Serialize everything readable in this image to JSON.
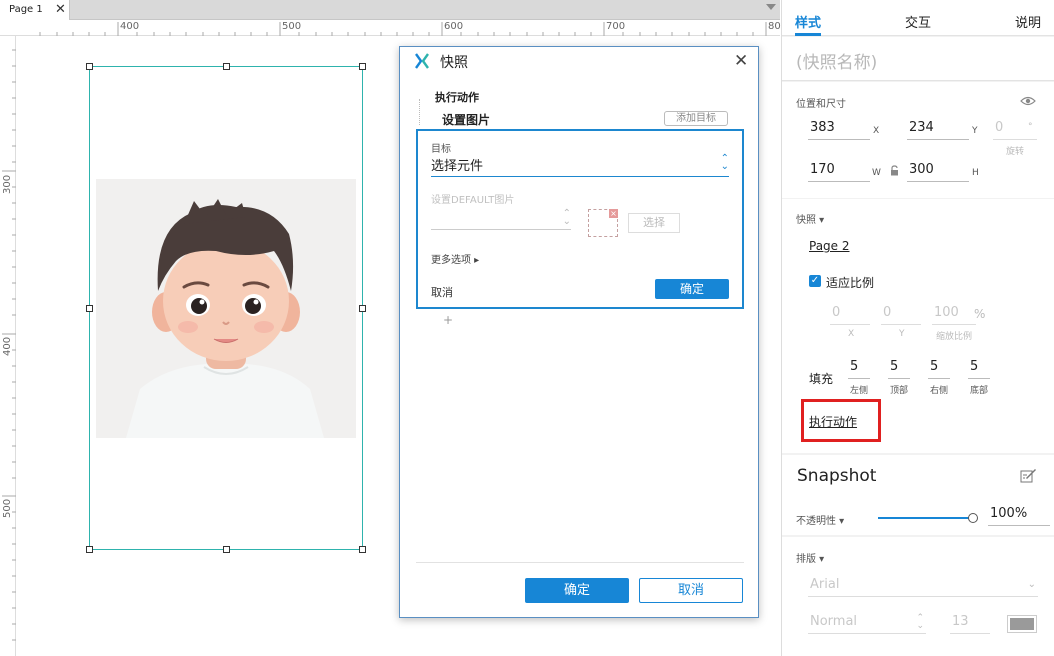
{
  "tabbar": {
    "page_tab": "Page 1",
    "close_glyph": "✕"
  },
  "ruler": {
    "top_labels": [
      "400",
      "500",
      "600",
      "700",
      "80"
    ],
    "left_labels": [
      "300",
      "400",
      "500"
    ]
  },
  "dialog": {
    "title": "快照",
    "close_glyph": "✕",
    "action_header": "执行动作",
    "action_sub": "设置图片",
    "add_target": "添加目标",
    "target_label": "目标",
    "target_select": "选择元件",
    "default_image_label": "设置DEFAULT图片",
    "choose_button": "选择",
    "more_options": "更多选项 ▸",
    "cancel_link": "取消",
    "ok_small": "确定",
    "add_plus": "+",
    "ok_button": "确定",
    "cancel_button": "取消"
  },
  "panel": {
    "tabs": {
      "style": "样式",
      "interact": "交互",
      "notes": "说明"
    },
    "snapshot_name_placeholder": "(快照名称)",
    "position_size": {
      "label": "位置和尺寸",
      "x": "383",
      "x_unit": "X",
      "y": "234",
      "y_unit": "Y",
      "rotation": "0",
      "rotation_unit": "°",
      "rotation_label": "旋转",
      "w": "170",
      "w_unit": "W",
      "h": "300",
      "h_unit": "H"
    },
    "snapshot": {
      "label": "快照 ▾",
      "page_link": "Page 2",
      "fit_checkbox": "适应比例",
      "fit_checked": true,
      "offset_x": "0",
      "offset_x_unit": "X",
      "offset_y": "0",
      "offset_y_unit": "Y",
      "scale": "100",
      "scale_unit": "%",
      "scale_label": "缩放比例"
    },
    "padding": {
      "label": "填充",
      "left": "5",
      "left_label": "左侧",
      "top": "5",
      "top_label": "顶部",
      "right": "5",
      "right_label": "右侧",
      "bottom": "5",
      "bottom_label": "底部"
    },
    "action_link": "执行动作",
    "snapshot_section_title": "Snapshot",
    "opacity": {
      "label": "不透明性 ▾",
      "value": "100%",
      "level": 1.0
    },
    "typography": {
      "label": "排版 ▾",
      "font": "Arial",
      "weight": "Normal",
      "size": "13"
    }
  },
  "colors": {
    "accent": "#1786d6",
    "selection": "#2eb3ad",
    "highlight": "#e02020"
  }
}
